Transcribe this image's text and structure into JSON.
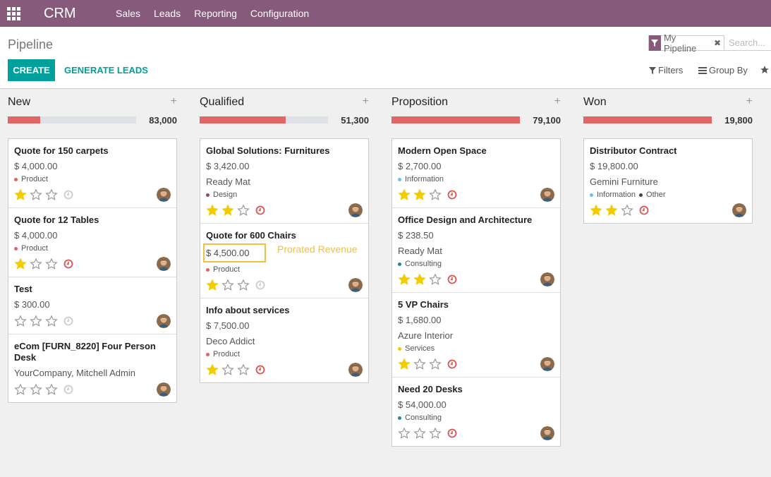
{
  "app": {
    "brand": "CRM",
    "menu": [
      "Sales",
      "Leads",
      "Reporting",
      "Configuration"
    ]
  },
  "control": {
    "breadcrumb": "Pipeline",
    "create_label": "CREATE",
    "generate_label": "GENERATE LEADS",
    "facet_label": "My Pipeline",
    "search_placeholder": "Search...",
    "filters_label": "Filters",
    "groupby_label": "Group By"
  },
  "colors": {
    "navbar": "#875a7b",
    "primary": "#00a09d",
    "progress": "#e06666",
    "star": "#f3cc00",
    "activity_overdue": "#d9534f",
    "highlight": "#f0c040"
  },
  "columns": [
    {
      "title": "New",
      "total": "83,000",
      "progress": 0.25,
      "cards": [
        {
          "title": "Quote for 150 carpets",
          "amount": "$ 4,000.00",
          "tags": [
            {
              "label": "Product",
              "color": "#e06666"
            }
          ],
          "stars": 1,
          "activity": "none"
        },
        {
          "title": "Quote for 12 Tables",
          "amount": "$ 4,000.00",
          "tags": [
            {
              "label": "Product",
              "color": "#e06666"
            }
          ],
          "stars": 1,
          "activity": "overdue"
        },
        {
          "title": "Test",
          "amount": "$ 300.00",
          "tags": [],
          "stars": 0,
          "activity": "none"
        },
        {
          "title": "eCom [FURN_8220] Four Person Desk",
          "customer": "YourCompany, Mitchell Admin",
          "tags": [],
          "stars": 0,
          "activity": "none"
        }
      ]
    },
    {
      "title": "Qualified",
      "total": "51,300",
      "progress": 0.67,
      "cards": [
        {
          "title": "Global Solutions: Furnitures",
          "amount": "$ 3,420.00",
          "customer": "Ready Mat",
          "tags": [
            {
              "label": "Design",
              "color": "#8e4a6b"
            }
          ],
          "stars": 2,
          "activity": "overdue"
        },
        {
          "title": "Quote for 600 Chairs",
          "amount": "$ 4,500.00",
          "highlight": "Prorated Revenue",
          "tags": [
            {
              "label": "Product",
              "color": "#e06666"
            }
          ],
          "stars": 1,
          "activity": "none"
        },
        {
          "title": "Info about services",
          "amount": "$ 7,500.00",
          "customer": "Deco Addict",
          "tags": [
            {
              "label": "Product",
              "color": "#e06666"
            }
          ],
          "stars": 1,
          "activity": "overdue"
        }
      ]
    },
    {
      "title": "Proposition",
      "total": "79,100",
      "progress": 1.0,
      "cards": [
        {
          "title": "Modern Open Space",
          "amount": "$ 2,700.00",
          "tags": [
            {
              "label": "Information",
              "color": "#6cc1ed"
            }
          ],
          "stars": 2,
          "activity": "overdue"
        },
        {
          "title": "Office Design and Architecture",
          "amount": "$ 238.50",
          "customer": "Ready Mat",
          "tags": [
            {
              "label": "Consulting",
              "color": "#2c8397"
            }
          ],
          "stars": 2,
          "activity": "overdue"
        },
        {
          "title": "5 VP Chairs",
          "amount": "$ 1,680.00",
          "customer": "Azure Interior",
          "tags": [
            {
              "label": "Services",
              "color": "#f4c609"
            }
          ],
          "stars": 1,
          "activity": "overdue"
        },
        {
          "title": "Need 20 Desks",
          "amount": "$ 54,000.00",
          "tags": [
            {
              "label": "Consulting",
              "color": "#2c8397"
            }
          ],
          "stars": 0,
          "activity": "overdue"
        }
      ]
    },
    {
      "title": "Won",
      "total": "19,800",
      "progress": 1.0,
      "cards": [
        {
          "title": "Distributor Contract",
          "amount": "$ 19,800.00",
          "customer": "Gemini Furniture",
          "tags": [
            {
              "label": "Information",
              "color": "#6cc1ed"
            },
            {
              "label": "Other",
              "color": "#444444"
            }
          ],
          "stars": 2,
          "activity": "overdue"
        }
      ]
    }
  ]
}
